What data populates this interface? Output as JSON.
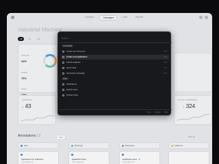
{
  "nav": {
    "items": [
      "Overview",
      "Campaigns",
      "Lists",
      "Reports"
    ]
  },
  "page": {
    "title": "Industrial Machine"
  },
  "filters": [
    "All",
    "Q1",
    "Q2"
  ],
  "kpis": [
    {
      "label": "Active sup.",
      "value": "24%",
      "color": "#4da3e8"
    },
    {
      "label": "Pending",
      "value": "76%",
      "color": "#f4a35a"
    },
    {
      "label": "Closed",
      "value": "13%",
      "color": "#6dc9b3"
    }
  ],
  "stats": [
    {
      "label": "Applications",
      "value": "43"
    },
    {
      "label": "Number of applications",
      "value": "324"
    }
  ],
  "annotations": {
    "title": "Annotations",
    "count": "12",
    "filter": "Filter",
    "view_all": "View all"
  },
  "columns": [
    {
      "label": "Idea",
      "color": "#4da3e8",
      "item_title": "Application for collection",
      "item_sub": "Last updated 2d"
    },
    {
      "label": "Prototype",
      "color": "#6dc9b3",
      "item_title": "Application item",
      "item_sub": "Last updated 4d"
    },
    {
      "label": "Discussion",
      "color": "#9aa0a8",
      "item_title": "Application item - 2",
      "item_sub": "Last updated 1w"
    },
    {
      "label": "Follow-up",
      "color": "#f4c35a",
      "item_title": "",
      "item_sub": ""
    }
  ],
  "palette": {
    "placeholder": "Search...",
    "section1": "Commands",
    "items1": [
      {
        "label": "Create new document",
        "key": "⌘ N"
      },
      {
        "label": "Create new application",
        "key": "⌘ A"
      },
      {
        "label": "Submit analytics",
        "key": "⌘ S"
      },
      {
        "label": "Import data",
        "key": "⌘ I"
      },
      {
        "label": "Summarize campaign",
        "key": "⌘ C"
      }
    ],
    "section2": "Links",
    "items2": [
      {
        "label": "Notifications",
        "key": ""
      },
      {
        "label": "Search users",
        "key": ""
      },
      {
        "label": "Product news",
        "key": ""
      }
    ],
    "footer": [
      "Open",
      "Navigate",
      "Close"
    ]
  }
}
